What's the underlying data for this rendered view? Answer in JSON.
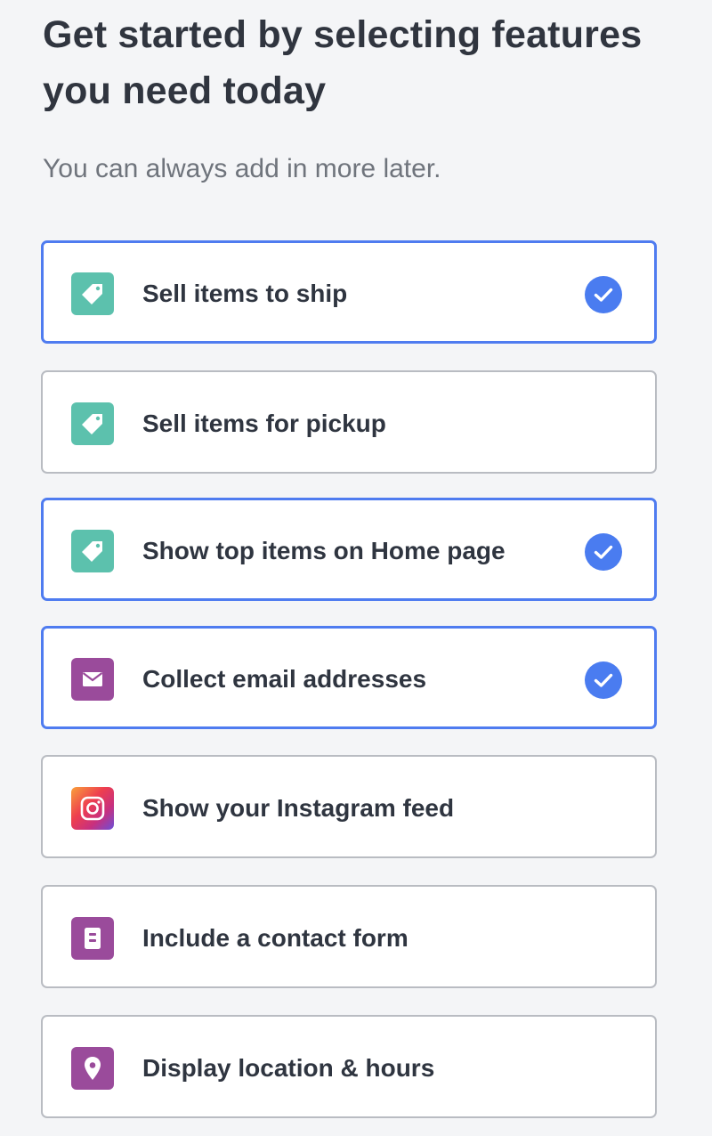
{
  "header": {
    "title": "Get started by selecting features you need today",
    "subtitle": "You can always add in more later."
  },
  "colors": {
    "selected_border": "#4f7cf0",
    "check_fill": "#4a7cf0",
    "tag_icon": "#5cc1ad",
    "purple_icon": "#9a4b9b",
    "card_border": "#b9bcc2",
    "background": "#f4f5f7"
  },
  "features": [
    {
      "label": "Sell items to ship",
      "icon": "tag-icon",
      "selected": true
    },
    {
      "label": "Sell items for pickup",
      "icon": "tag-icon",
      "selected": false
    },
    {
      "label": "Show top items on Home page",
      "icon": "tag-icon",
      "selected": true
    },
    {
      "label": "Collect email addresses",
      "icon": "envelope-icon",
      "selected": true
    },
    {
      "label": "Show your Instagram feed",
      "icon": "instagram-icon",
      "selected": false
    },
    {
      "label": "Include a contact form",
      "icon": "form-icon",
      "selected": false
    },
    {
      "label": "Display location & hours",
      "icon": "location-pin-icon",
      "selected": false
    }
  ]
}
